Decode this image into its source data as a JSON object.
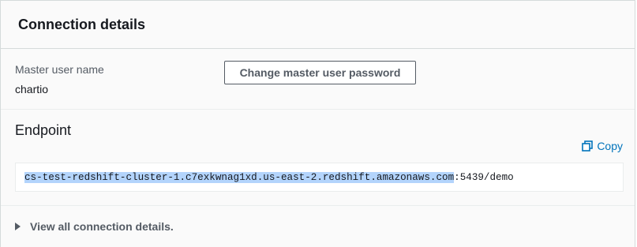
{
  "header": {
    "title": "Connection details"
  },
  "master_user": {
    "label": "Master user name",
    "value": "chartio",
    "change_password_label": "Change master user password"
  },
  "endpoint": {
    "title": "Endpoint",
    "copy_label": "Copy",
    "host": "cs-test-redshift-cluster-1.c7exkwnag1xd.us-east-2.redshift.amazonaws.com",
    "suffix": ":5439/demo"
  },
  "more": {
    "label": "View all connection details."
  },
  "colors": {
    "accent": "#0073bb",
    "selection": "#b3d4fc"
  }
}
